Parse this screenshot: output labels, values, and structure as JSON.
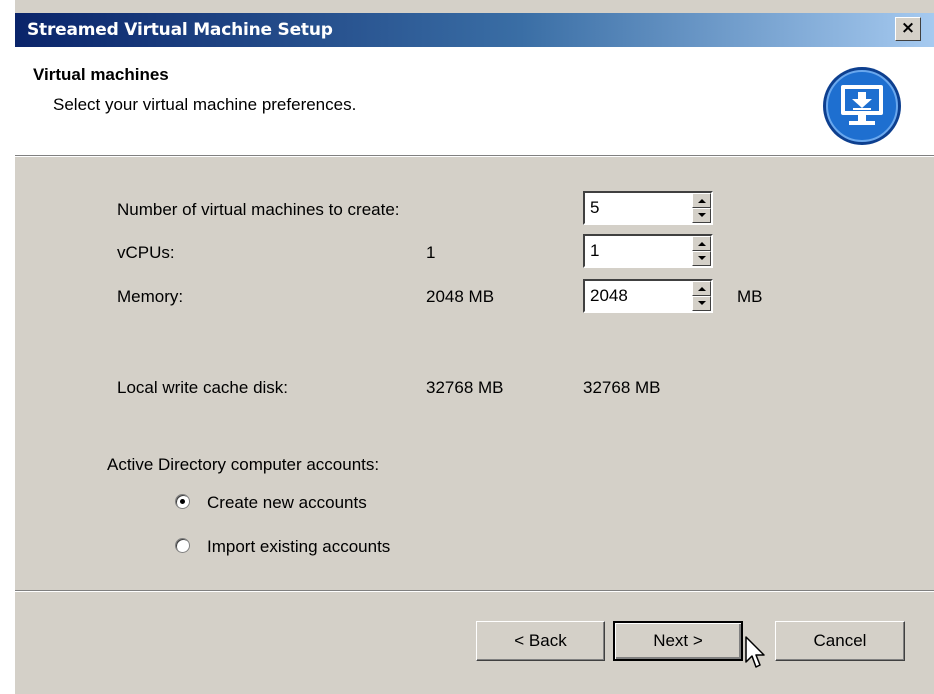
{
  "window": {
    "title": "Streamed Virtual Machine Setup",
    "close_label": "×"
  },
  "header": {
    "title": "Virtual machines",
    "subtitle": "Select your virtual machine preferences.",
    "icon": "computer-download-icon"
  },
  "form": {
    "num_vms": {
      "label": "Number of virtual machines to create:",
      "value": "5"
    },
    "vcpus": {
      "label": "vCPUs:",
      "default": "1",
      "value": "1"
    },
    "memory": {
      "label": "Memory:",
      "default": "2048 MB",
      "value": "2048",
      "unit": "MB"
    },
    "cache_disk": {
      "label": "Local write cache disk:",
      "default": "32768 MB",
      "value": "32768 MB"
    },
    "ad_accounts": {
      "label": "Active Directory computer accounts:",
      "options": [
        {
          "label": "Create new accounts",
          "selected": true
        },
        {
          "label": "Import existing accounts",
          "selected": false
        }
      ]
    }
  },
  "buttons": {
    "back": "< Back",
    "next": "Next >",
    "cancel": "Cancel"
  },
  "colors": {
    "titlebar_start": "#0a246a",
    "titlebar_end": "#a6caf0",
    "dialog_bg": "#d4d0c8",
    "icon_blue": "#1565c0"
  }
}
